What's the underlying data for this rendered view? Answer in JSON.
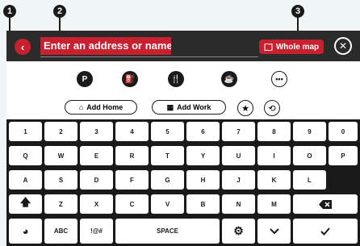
{
  "callouts": [
    "1",
    "2",
    "3"
  ],
  "header": {
    "back_icon": "chevron-left-icon",
    "search_placeholder": "Enter an address or name",
    "whole_map_label": "Whole map",
    "map_icon": "map-icon",
    "close_icon": "close-icon"
  },
  "categories": [
    "P",
    "fuel",
    "restaurant",
    "cafe",
    "more"
  ],
  "shortcuts": {
    "add_home": "Add Home",
    "add_work": "Add Work",
    "favorites_icon": "star-icon",
    "recent_icon": "history-icon"
  },
  "keyboard": {
    "row1": [
      "1",
      "2",
      "3",
      "4",
      "5",
      "6",
      "7",
      "8",
      "9",
      "0"
    ],
    "row2": [
      "Q",
      "W",
      "E",
      "R",
      "T",
      "Y",
      "U",
      "I",
      "O",
      "P"
    ],
    "row3": [
      "A",
      "S",
      "D",
      "F",
      "G",
      "H",
      "J",
      "K",
      "L"
    ],
    "row4": [
      "Z",
      "X",
      "C",
      "V",
      "B",
      "N",
      "M"
    ],
    "abc": "ABC",
    "symbols": "!@#",
    "space": "SPACE",
    "shift_icon": "shift-icon",
    "backspace_icon": "backspace-icon",
    "globe_icon": "globe-icon",
    "settings_icon": "gear-icon",
    "hide_icon": "chevron-down-icon",
    "done_icon": "checkmark-icon"
  }
}
